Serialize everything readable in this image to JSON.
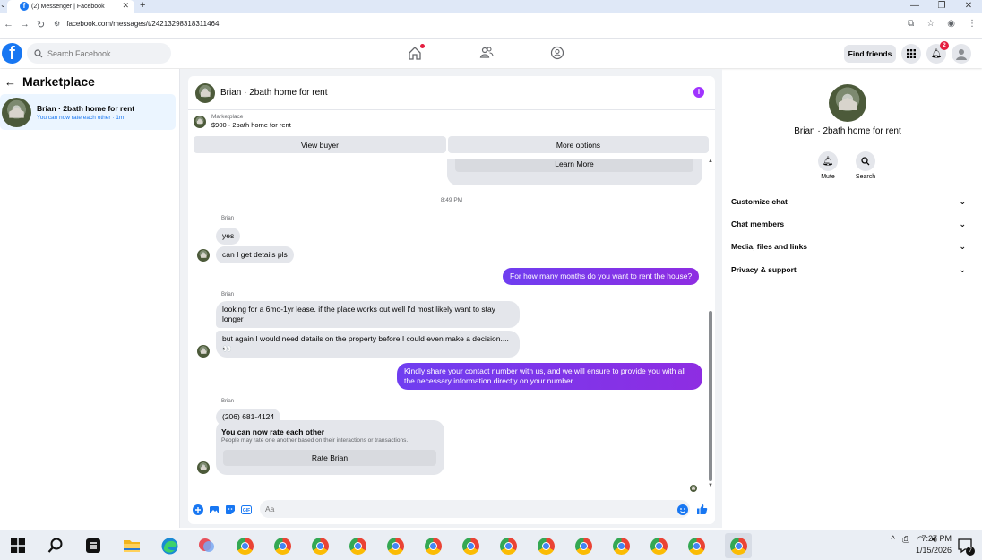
{
  "browser": {
    "tab_title": "(2) Messenger | Facebook",
    "url": "facebook.com/messages/t/24213298318311464"
  },
  "header": {
    "search_placeholder": "Search Facebook",
    "find_friends_label": "Find friends",
    "notifications_count": "2"
  },
  "sidebar": {
    "title": "Marketplace",
    "conversations": [
      {
        "name": "Brian · 2bath home for rent",
        "preview": "You can now rate each other · 1m"
      }
    ]
  },
  "chat": {
    "title": "Brian · 2bath home for rent",
    "listing": {
      "label": "Marketplace",
      "value": "$900 · 2bath home for rent"
    },
    "view_buyer_label": "View buyer",
    "more_options_label": "More options",
    "learn_more_label": "Learn More",
    "timestamp": "8:49 PM",
    "messages": [
      {
        "sender": "Brian",
        "text": "yes"
      },
      {
        "text": "can I get details pls"
      },
      {
        "outgoing": true,
        "text": "For how many months do you want to rent the house?"
      },
      {
        "sender": "Brian",
        "text": "looking for a 6mo-1yr lease. if the place works out well I'd most likely want to stay longer"
      },
      {
        "text": "but again I would need details on the property before I could even make a decision.... 👀"
      },
      {
        "outgoing": true,
        "text": "Kindly share your contact number with us, and we will ensure to provide you with all the necessary information directly on your number."
      },
      {
        "sender": "Brian",
        "text": "(206) 681-4124"
      }
    ],
    "rating": {
      "title": "You can now rate each other",
      "subtitle": "People may rate one another based on their interactions or transactions.",
      "button_label": "Rate Brian"
    },
    "composer_placeholder": "Aa"
  },
  "details_panel": {
    "name": "Brian · 2bath home for rent",
    "mute_label": "Mute",
    "search_label": "Search",
    "sections": [
      "Customize chat",
      "Chat members",
      "Media, files and links",
      "Privacy & support"
    ]
  },
  "taskbar": {
    "time": "7:27 PM",
    "date": "1/15/2026",
    "notify_count": "7"
  },
  "colors": {
    "fb_blue": "#1877f2",
    "outgoing_bubble": "#7b35e8",
    "notification_red": "#e41e3f"
  }
}
